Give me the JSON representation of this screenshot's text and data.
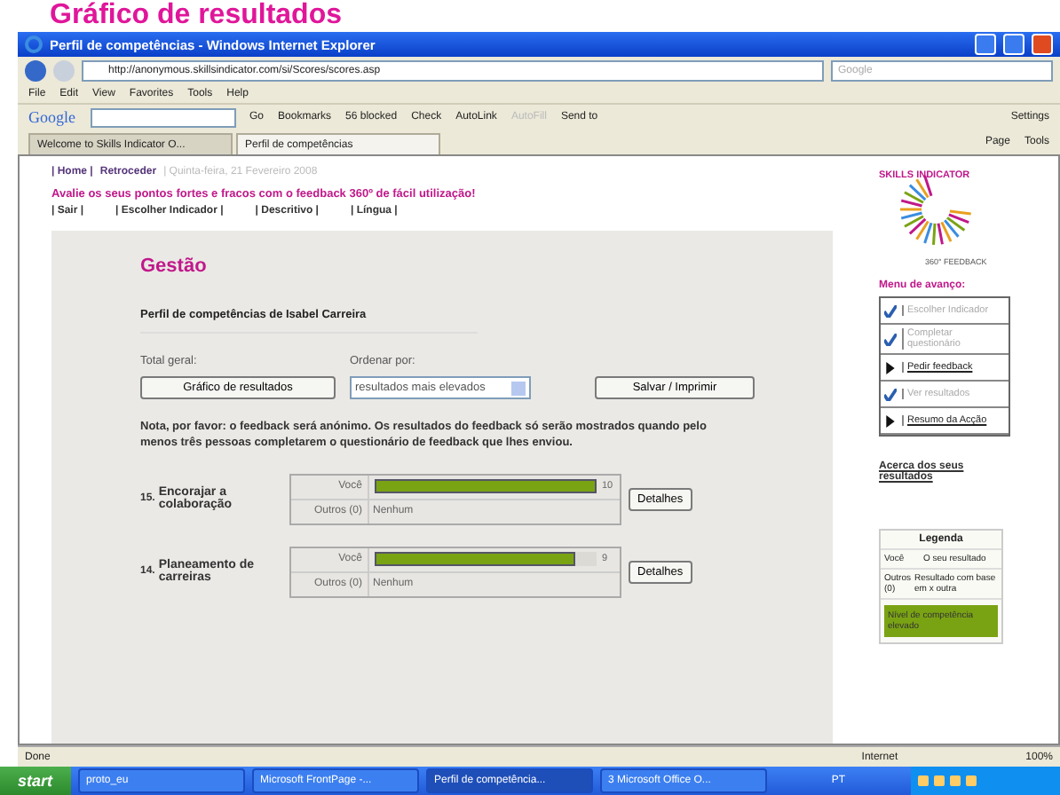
{
  "slide_title": "Gráfico de resultados",
  "window": {
    "title": "Perfil de competências - Windows Internet Explorer"
  },
  "address_bar": {
    "url": "http://anonymous.skillsindicator.com/si/Scores/scores.asp",
    "search_placeholder": "Google"
  },
  "menu_bar": [
    "File",
    "Edit",
    "View",
    "Favorites",
    "Tools",
    "Help"
  ],
  "google_toolbar": {
    "label": "Google",
    "items": [
      "Go",
      "Bookmarks",
      "56 blocked",
      "Check",
      "AutoLink",
      "AutoFill",
      "Send to"
    ],
    "settings": "Settings"
  },
  "tabs": [
    {
      "label": "Welcome to Skills Indicator O...",
      "selected": false
    },
    {
      "label": "Perfil de competências",
      "selected": true
    }
  ],
  "command_bar": [
    "Page",
    "Tools"
  ],
  "page": {
    "top_links": [
      "| Home |",
      "Retroceder"
    ],
    "date": "| Quinta-feira, 21 Fevereiro 2008",
    "tagline": "Avalie os seus pontos fortes e fracos com o feedback 360º de fácil utilização!",
    "nav": [
      "| Sair |",
      "| Escolher Indicador |",
      "| Descritivo |",
      "| Língua |"
    ],
    "heading": "Gestão",
    "subheading": "Perfil de competências de Isabel Carreira",
    "total_label": "Total geral:",
    "sort_label": "Ordenar por:",
    "chart_button": "Gráfico de resultados",
    "sort_value": "resultados mais elevados",
    "save_button": "Salvar / Imprimir",
    "note": "Nota, por favor: o feedback será anónimo. Os resultados do feedback só serão mostrados quando pelo menos três pessoas completarem o questionário de feedback que lhes enviou.",
    "results": [
      {
        "number": "15.",
        "name": "Encorajar a colaboração",
        "you_label": "Você",
        "level": 1.0,
        "score": "10",
        "others_label": "Outros (0)",
        "others_value": "Nenhum",
        "button": "Detalhes"
      },
      {
        "number": "14.",
        "name": "Planeamento de carreiras",
        "you_label": "Você",
        "level": 0.9,
        "score": "9",
        "others_label": "Outros (0)",
        "others_value": "Nenhum",
        "button": "Detalhes"
      }
    ]
  },
  "sidebar": {
    "logo_text": [
      "SKILLS INDICATOR",
      "360° FEEDBACK"
    ],
    "menu_title": "Menu de avanço:",
    "menu": [
      {
        "label": "Escolher Indicador",
        "checked": true
      },
      {
        "label": "Completar questionário",
        "checked": true
      },
      {
        "label": "Pedir feedback",
        "checked": false
      },
      {
        "label": "Ver resultados",
        "checked": true
      },
      {
        "label": "Resumo da Acção",
        "checked": false
      }
    ],
    "about_link": "Acerca dos seus resultados",
    "legend": {
      "title": "Legenda",
      "rows": [
        {
          "key": "Você",
          "value": "O seu resultado"
        },
        {
          "key": "Outros (0)",
          "value": "Resultado com base em x outra"
        }
      ],
      "high_label": "Nível de competência elevado"
    }
  },
  "status_bar": {
    "text": "Done",
    "zone": "Internet",
    "zoom": "100%"
  },
  "taskbar": {
    "start": "start",
    "items": [
      {
        "label": "proto_eu",
        "selected": false
      },
      {
        "label": "Microsoft FrontPage -...",
        "selected": false
      },
      {
        "label": "Perfil de competência...",
        "selected": true
      },
      {
        "label": "3 Microsoft Office O...",
        "selected": false
      }
    ],
    "language": "PT"
  }
}
